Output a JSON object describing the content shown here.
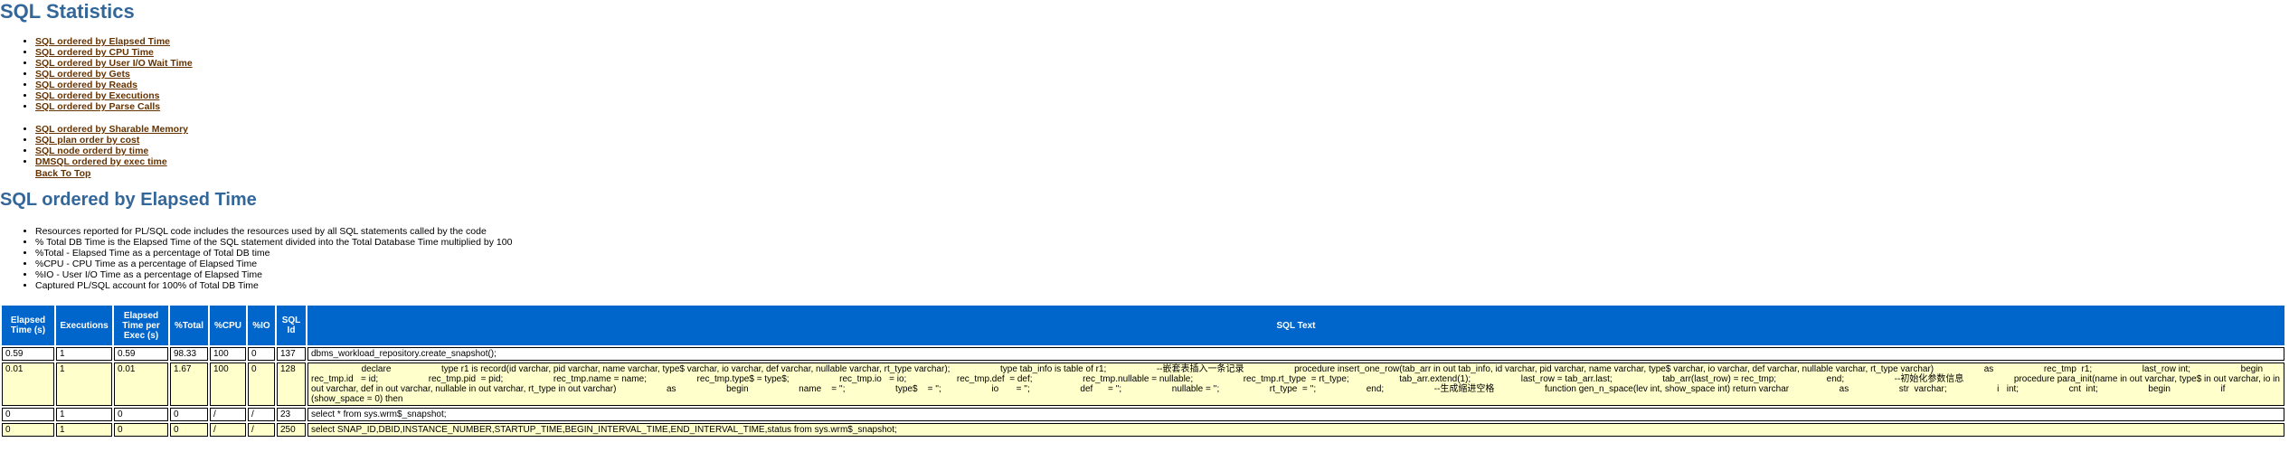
{
  "page_title": "SQL Statistics",
  "links_group1": [
    "SQL ordered by Elapsed Time",
    "SQL ordered by CPU Time",
    "SQL ordered by User I/O Wait Time",
    "SQL ordered by Gets",
    "SQL ordered by Reads",
    "SQL ordered by Executions",
    "SQL ordered by Parse Calls"
  ],
  "links_group2": [
    "SQL ordered by Sharable Memory",
    "SQL plan order by cost",
    "SQL node orderd by time",
    "DMSQL ordered by exec time"
  ],
  "back_to_top": "Back To Top",
  "section_title": "SQL ordered by Elapsed Time",
  "notes": [
    "Resources reported for PL/SQL code includes the resources used by all SQL statements called by the code",
    "% Total DB Time is the Elapsed Time of the SQL statement divided into the Total Database Time multiplied by 100",
    "%Total - Elapsed Time as a percentage of Total DB time",
    "%CPU - CPU Time as a percentage of Elapsed Time",
    "%IO - User I/O Time as a percentage of Elapsed Time",
    "Captured PL/SQL account for 100% of Total DB Time"
  ],
  "table": {
    "headers": [
      "Elapsed Time (s)",
      "Executions",
      "Elapsed Time per Exec (s)",
      "%Total",
      "%CPU",
      "%IO",
      "SQL Id",
      "SQL Text"
    ],
    "rows": [
      [
        "0.59",
        "1",
        "0.59",
        "98.33",
        "100",
        "0",
        "137",
        "dbms_workload_repository.create_snapshot();"
      ],
      [
        "0.01",
        "1",
        "0.01",
        "1.67",
        "100",
        "0",
        "128",
        "                    declare                    type r1 is record(id varchar, pid varchar, name varchar, type$ varchar, io varchar, def varchar, nullable varchar, rt_type varchar);                    type tab_info is table of r1;                    --嵌套表插入一条记录                    procedure insert_one_row(tab_arr in out tab_info, id varchar, pid varchar, name varchar, type$ varchar, io varchar, def varchar, nullable varchar, rt_type varchar)                    as                    rec_tmp  r1;                    last_row int;                    begin                    rec_tmp.id   = id;                    rec_tmp.pid  = pid;                    rec_tmp.name = name;                    rec_tmp.type$ = type$;                    rec_tmp.io   = io;                    rec_tmp.def  = def;                    rec_tmp.nullable = nullable;                    rec_tmp.rt_type  = rt_type;                    tab_arr.extend(1);                    last_row = tab_arr.last;                    tab_arr(last_row) = rec_tmp;                    end;                    --初始化参数信息                    procedure para_init(name in out varchar, type$ in out varchar, io in out varchar, def in out varchar, nullable in out varchar, rt_type in out varchar)                    as                    begin                    name    = '';                    type$    = '';                    io       = '';                    def      = '';                    nullable = '';                    rt_type  = '';                    end;                    --生成缩进空格                    function gen_n_space(lev int, show_space int) return varchar                    as                    str  varchar;                    i   int;                    cnt  int;                    begin                    if (show_space = 0) then"
      ],
      [
        "0",
        "1",
        "0",
        "0",
        "/",
        "/",
        "23",
        "select * from sys.wrm$_snapshot;"
      ],
      [
        "0",
        "1",
        "0",
        "0",
        "/",
        "/",
        "250",
        "select SNAP_ID,DBID,INSTANCE_NUMBER,STARTUP_TIME,BEGIN_INTERVAL_TIME,END_INTERVAL_TIME,status from sys.wrm$_snapshot;"
      ]
    ]
  }
}
